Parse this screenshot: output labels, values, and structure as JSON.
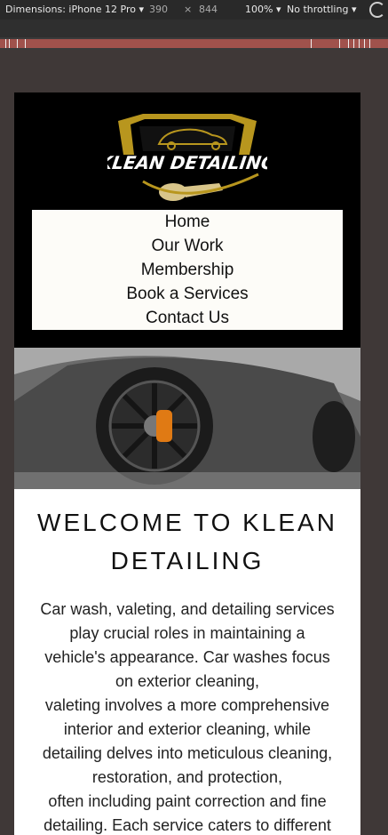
{
  "devtools": {
    "device": "Dimensions: iPhone 12 Pro",
    "width": "390",
    "times": "×",
    "height": "844",
    "zoom": "100%",
    "throttling": "No throttling"
  },
  "site": {
    "logo_text": "KLEAN DETAILING",
    "nav": [
      "Home",
      "Our Work",
      "Membership",
      "Book a Services",
      "Contact Us"
    ],
    "welcome_line1": "WELCOME TO KLEAN",
    "welcome_line2": "DETAILING",
    "paragraph_lines": [
      "Car wash, valeting, and detailing services",
      "play crucial roles in maintaining a",
      "vehicle's appearance. Car washes focus",
      "on exterior cleaning,",
      "valeting involves a more comprehensive",
      "interior and exterior cleaning, while",
      "detailing delves into meticulous cleaning,",
      "restoration, and protection,",
      "often including paint correction and fine",
      "detailing. Each service caters to different"
    ]
  },
  "colors": {
    "header_bg": "#000000",
    "logo_gold": "#b8961e",
    "nav_bg": "#fdfcf8"
  },
  "icons": [
    "chevron-down-icon",
    "rotate-icon"
  ]
}
